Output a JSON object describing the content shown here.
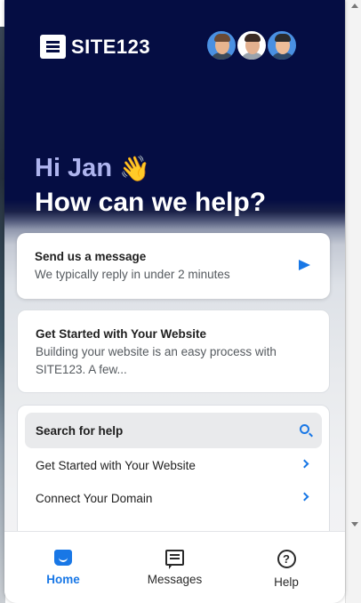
{
  "brand": {
    "name": "SITE123"
  },
  "header": {
    "greeting": "Hi Jan",
    "wave": "👋",
    "headline": "How can we help?",
    "avatars": [
      {
        "icon": "agent-avatar-1",
        "skin": "#e8b48e",
        "hair": "#6b4a34",
        "shirt": "#3b4a5a",
        "bg": "#4a90e2"
      },
      {
        "icon": "agent-avatar-2",
        "skin": "#e3b08f",
        "hair": "#3a2a24",
        "shirt": "#9aa3ad",
        "bg": "#ffffff"
      },
      {
        "icon": "agent-avatar-3",
        "skin": "#eebd98",
        "hair": "#2b2b2b",
        "shirt": "#2f4a6a",
        "bg": "#4a90e2"
      }
    ]
  },
  "message_card": {
    "title": "Send us a message",
    "subtitle": "We typically reply in under 2 minutes",
    "icon": "send-icon"
  },
  "article_card": {
    "title": "Get Started with Your Website",
    "excerpt": "Building your website is an easy process with SITE123. A few..."
  },
  "help": {
    "search_label": "Search for help",
    "links": [
      {
        "label": "Get Started with Your Website"
      },
      {
        "label": "Connect Your Domain"
      }
    ]
  },
  "tabs": [
    {
      "label": "Home",
      "icon": "home-icon",
      "active": true
    },
    {
      "label": "Messages",
      "icon": "messages-icon",
      "active": false
    },
    {
      "label": "Help",
      "icon": "help-icon",
      "active": false
    }
  ],
  "colors": {
    "accent": "#1877e6",
    "header_bg": "#050d43",
    "greeting": "#aeb4ee"
  }
}
